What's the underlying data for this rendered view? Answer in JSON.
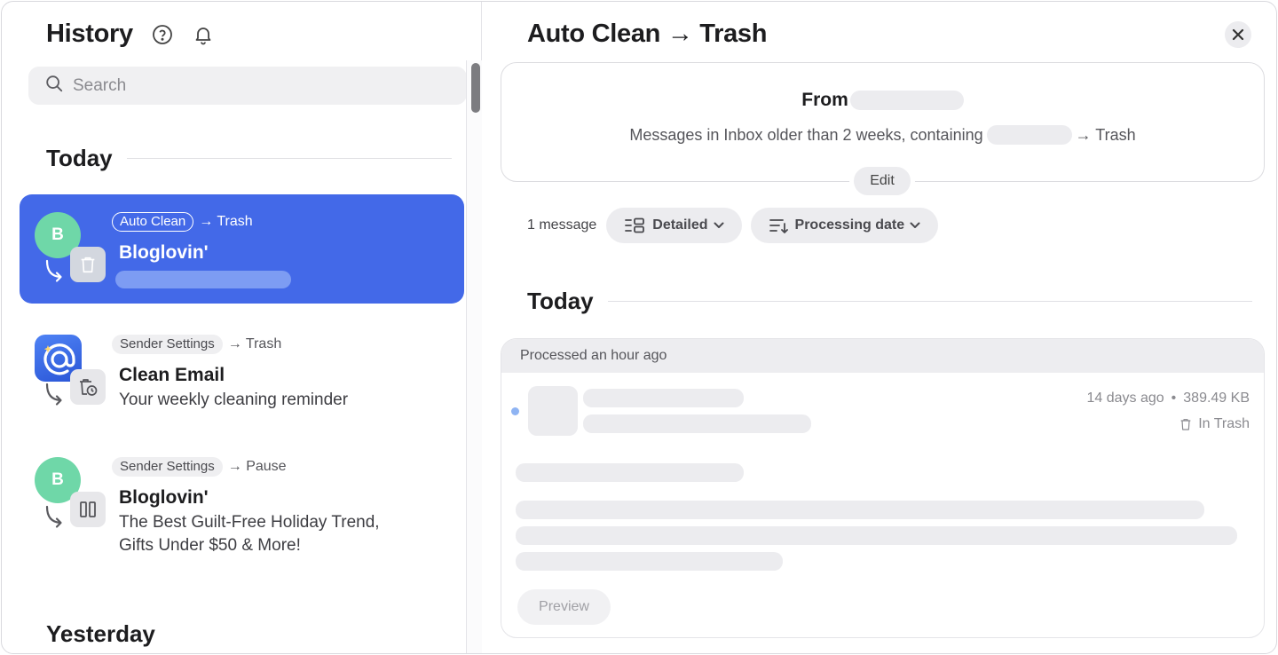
{
  "sidebar": {
    "title": "History",
    "search": {
      "placeholder": "Search",
      "value": ""
    },
    "sections": {
      "today": "Today",
      "yesterday": "Yesterday"
    },
    "items": [
      {
        "avatar_letter": "B",
        "tag": "Auto Clean",
        "destination": "→ Trash",
        "title": "Bloglovin'",
        "subtitle": "",
        "action_icon": "trash-icon",
        "selected": true
      },
      {
        "avatar_icon": "at-sign-app-icon",
        "tag": "Sender Settings",
        "destination": "→ Trash",
        "title": "Clean Email",
        "subtitle": "Your weekly cleaning reminder",
        "action_icon": "trash-clock-icon",
        "selected": false
      },
      {
        "avatar_letter": "B",
        "tag": "Sender Settings",
        "destination": "→ Pause",
        "title": "Bloglovin'",
        "subtitle_line1": "The Best Guilt-Free Holiday Trend,",
        "subtitle_line2": "Gifts Under $50 & More!",
        "action_icon": "pause-icon",
        "selected": false
      }
    ]
  },
  "detail": {
    "title": "Auto Clean → Trash",
    "rule": {
      "from_label": "From",
      "description_prefix": "Messages in Inbox older than 2 weeks, containing",
      "description_suffix": "→ Trash",
      "edit_label": "Edit"
    },
    "toolbar": {
      "count": "1 message",
      "view_label": "Detailed",
      "sort_label": "Processing date"
    },
    "section_today": "Today",
    "message": {
      "processed": "Processed an hour ago",
      "age": "14 days ago",
      "separator": "•",
      "size": "389.49 KB",
      "status": "In Trash",
      "preview_label": "Preview"
    }
  },
  "colors": {
    "accent": "#4369e8",
    "avatar_green": "#6fd7a8",
    "redacted": "#ececef"
  }
}
